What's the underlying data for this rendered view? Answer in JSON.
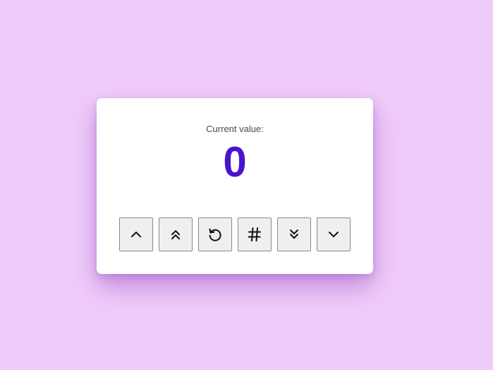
{
  "counter": {
    "label": "Current value:",
    "value": "0"
  },
  "colors": {
    "background": "#f0ccfb",
    "card": "#ffffff",
    "value_text": "#4a13cf"
  },
  "buttons": [
    {
      "name": "increment-button",
      "icon": "chevron-up-icon"
    },
    {
      "name": "big-increment-button",
      "icon": "double-chevron-up-icon"
    },
    {
      "name": "reset-button",
      "icon": "reset-icon"
    },
    {
      "name": "set-value-button",
      "icon": "hash-icon"
    },
    {
      "name": "big-decrement-button",
      "icon": "double-chevron-down-icon"
    },
    {
      "name": "decrement-button",
      "icon": "chevron-down-icon"
    }
  ]
}
